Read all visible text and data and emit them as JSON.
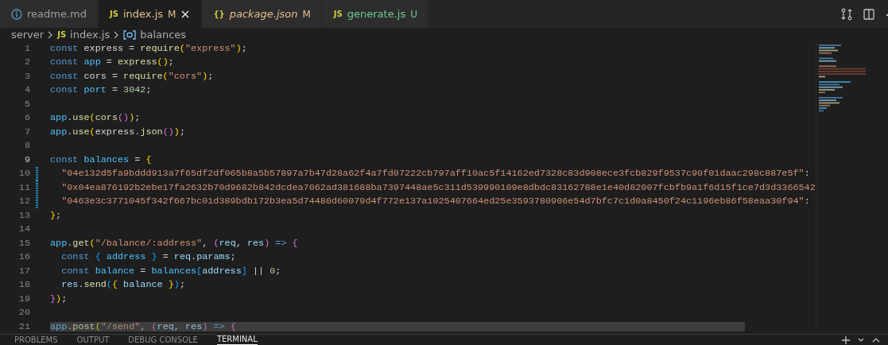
{
  "tabs": [
    {
      "kind": "info",
      "label": "readme.md",
      "selected": false,
      "italic": false,
      "color": "#9d9d9d"
    },
    {
      "kind": "badge",
      "badge": "JS",
      "label": "index.js",
      "status": "M",
      "selected": true,
      "italic": false,
      "color": "#e2c08d"
    },
    {
      "kind": "badge",
      "badge": "{}",
      "label": "package.json",
      "status": "M",
      "selected": false,
      "italic": true,
      "color": "#e2c08d"
    },
    {
      "kind": "badge",
      "badge": "JS",
      "label": "generate.js",
      "status": "U",
      "selected": false,
      "italic": false,
      "color": "#73c991"
    }
  ],
  "breadcrumb": [
    {
      "kind": "folder",
      "label": "server"
    },
    {
      "kind": "badge",
      "label": "index.js",
      "badge": "JS"
    },
    {
      "kind": "symbol",
      "label": "balances"
    }
  ],
  "lines": [
    {
      "number": "1",
      "active": false,
      "modified": false,
      "tokens": [
        {
          "kind": "keyword",
          "text": "const"
        },
        {
          "kind": "text",
          "text": " express = "
        },
        {
          "kind": "function",
          "text": "require"
        },
        {
          "kind": "bracket1",
          "text": "("
        },
        {
          "kind": "string",
          "text": "\"express\""
        },
        {
          "kind": "bracket1",
          "text": ")"
        },
        {
          "kind": "text",
          "text": ";"
        }
      ]
    },
    {
      "number": "2",
      "active": false,
      "modified": false,
      "tokens": [
        {
          "kind": "keyword",
          "text": "const"
        },
        {
          "kind": "constant",
          "text": " app"
        },
        {
          "kind": "text",
          "text": " = "
        },
        {
          "kind": "function",
          "text": "express"
        },
        {
          "kind": "bracket1",
          "text": "()"
        },
        {
          "kind": "text",
          "text": ";"
        }
      ]
    },
    {
      "number": "3",
      "active": false,
      "modified": false,
      "tokens": [
        {
          "kind": "keyword",
          "text": "const"
        },
        {
          "kind": "text",
          "text": " cors = "
        },
        {
          "kind": "function",
          "text": "require"
        },
        {
          "kind": "bracket1",
          "text": "("
        },
        {
          "kind": "string",
          "text": "\"cors\""
        },
        {
          "kind": "bracket1",
          "text": ")"
        },
        {
          "kind": "text",
          "text": ";"
        }
      ]
    },
    {
      "number": "4",
      "active": false,
      "modified": false,
      "tokens": [
        {
          "kind": "keyword",
          "text": "const"
        },
        {
          "kind": "constant",
          "text": " port"
        },
        {
          "kind": "text",
          "text": " = "
        },
        {
          "kind": "number",
          "text": "3042"
        },
        {
          "kind": "text",
          "text": ";"
        }
      ]
    },
    {
      "number": "5",
      "active": false,
      "modified": false
    },
    {
      "number": "6",
      "active": false,
      "modified": false,
      "tokens": [
        {
          "kind": "constant",
          "text": "app"
        },
        {
          "kind": "text",
          "text": "."
        },
        {
          "kind": "function",
          "text": "use"
        },
        {
          "kind": "bracket1",
          "text": "("
        },
        {
          "kind": "function",
          "text": "cors"
        },
        {
          "kind": "bracket2",
          "text": "()"
        },
        {
          "kind": "bracket1",
          "text": ")"
        },
        {
          "kind": "text",
          "text": ";"
        }
      ]
    },
    {
      "number": "7",
      "active": false,
      "modified": false,
      "tokens": [
        {
          "kind": "constant",
          "text": "app"
        },
        {
          "kind": "text",
          "text": "."
        },
        {
          "kind": "function",
          "text": "use"
        },
        {
          "kind": "bracket1",
          "text": "("
        },
        {
          "kind": "text",
          "text": "express."
        },
        {
          "kind": "function",
          "text": "json"
        },
        {
          "kind": "bracket2",
          "text": "()"
        },
        {
          "kind": "bracket1",
          "text": ")"
        },
        {
          "kind": "text",
          "text": ";"
        }
      ]
    },
    {
      "number": "8",
      "active": false,
      "modified": false
    },
    {
      "number": "9",
      "active": true,
      "modified": false,
      "tokens": [
        {
          "kind": "keyword",
          "text": "const"
        },
        {
          "kind": "constant",
          "text": " balances"
        },
        {
          "kind": "text",
          "text": " = "
        },
        {
          "kind": "bracket1",
          "text": "{"
        }
      ]
    },
    {
      "number": "10",
      "active": false,
      "modified": true,
      "tokens": [
        {
          "kind": "string",
          "text": "  \"04e132d5fa9bddd913a7f65df2df065b8a5b57897a7b47d28a62f4a7fd07222cb797aff10ac5f14162ed7328c83d908ece3fcb829f9537c90f01daac298c887e5f\""
        },
        {
          "kind": "text",
          "text": ":"
        }
      ]
    },
    {
      "number": "11",
      "active": false,
      "modified": true,
      "tokens": [
        {
          "kind": "string",
          "text": "  \"0x04ea876192b2ebe17fa2632b70d9682b842dcdea7062ad381688ba7397448ae5c311d539990109e8dbdc83162788e1e40d82007fcbfb9a1f6d15f1ce7d3d3366542"
        }
      ]
    },
    {
      "number": "12",
      "active": false,
      "modified": true,
      "tokens": [
        {
          "kind": "string",
          "text": "  \"0463e3c3771045f342f667bc01d389bdb172b3ea5d74480d60079d4f772e137a1025407664ed25e3593780906e54d7bfc7c1d0a8450f24c1196eb86f58eaa30f94\""
        },
        {
          "kind": "text",
          "text": ":"
        }
      ]
    },
    {
      "number": "13",
      "active": false,
      "modified": false,
      "tokens": [
        {
          "kind": "bracket1",
          "text": "}"
        },
        {
          "kind": "text",
          "text": ";"
        }
      ]
    },
    {
      "number": "14",
      "active": false,
      "modified": false
    },
    {
      "number": "15",
      "active": false,
      "modified": false,
      "tokens": [
        {
          "kind": "constant",
          "text": "app"
        },
        {
          "kind": "text",
          "text": "."
        },
        {
          "kind": "function",
          "text": "get"
        },
        {
          "kind": "bracket1",
          "text": "("
        },
        {
          "kind": "string",
          "text": "\"/balance/:address\""
        },
        {
          "kind": "text",
          "text": ", "
        },
        {
          "kind": "bracket2",
          "text": "("
        },
        {
          "kind": "variable",
          "text": "req"
        },
        {
          "kind": "text",
          "text": ", "
        },
        {
          "kind": "variable",
          "text": "res"
        },
        {
          "kind": "bracket2",
          "text": ")"
        },
        {
          "kind": "keyword",
          "text": " => "
        },
        {
          "kind": "bracket2",
          "text": "{"
        }
      ]
    },
    {
      "number": "16",
      "active": false,
      "modified": false,
      "tokens": [
        {
          "kind": "keyword",
          "text": "  const "
        },
        {
          "kind": "bracket3",
          "text": "{"
        },
        {
          "kind": "constant",
          "text": " address "
        },
        {
          "kind": "bracket3",
          "text": "}"
        },
        {
          "kind": "text",
          "text": " = "
        },
        {
          "kind": "variable",
          "text": "req"
        },
        {
          "kind": "text",
          "text": "."
        },
        {
          "kind": "variable",
          "text": "params"
        },
        {
          "kind": "text",
          "text": ";"
        }
      ]
    },
    {
      "number": "17",
      "active": false,
      "modified": false,
      "tokens": [
        {
          "kind": "keyword",
          "text": "  const"
        },
        {
          "kind": "constant",
          "text": " balance"
        },
        {
          "kind": "text",
          "text": " = "
        },
        {
          "kind": "constant",
          "text": "balances"
        },
        {
          "kind": "bracket3",
          "text": "["
        },
        {
          "kind": "variable",
          "text": "address"
        },
        {
          "kind": "bracket3",
          "text": "]"
        },
        {
          "kind": "text",
          "text": " || "
        },
        {
          "kind": "number",
          "text": "0"
        },
        {
          "kind": "text",
          "text": ";"
        }
      ]
    },
    {
      "number": "18",
      "active": false,
      "modified": false,
      "tokens": [
        {
          "kind": "variable",
          "text": "  res"
        },
        {
          "kind": "text",
          "text": "."
        },
        {
          "kind": "function",
          "text": "send"
        },
        {
          "kind": "bracket3",
          "text": "("
        },
        {
          "kind": "bracket1",
          "text": "{"
        },
        {
          "kind": "variable",
          "text": " balance "
        },
        {
          "kind": "bracket1",
          "text": "}"
        },
        {
          "kind": "bracket3",
          "text": ")"
        },
        {
          "kind": "text",
          "text": ";"
        }
      ]
    },
    {
      "number": "19",
      "active": false,
      "modified": false,
      "tokens": [
        {
          "kind": "bracket2",
          "text": "}"
        },
        {
          "kind": "bracket1",
          "text": ")"
        },
        {
          "kind": "text",
          "text": ";"
        }
      ]
    },
    {
      "number": "20",
      "active": false,
      "modified": false
    },
    {
      "number": "21",
      "active": false,
      "modified": false,
      "tokens": [
        {
          "kind": "constant",
          "text": "app"
        },
        {
          "kind": "text",
          "text": "."
        },
        {
          "kind": "function",
          "text": "post"
        },
        {
          "kind": "bracket1",
          "text": "("
        },
        {
          "kind": "string",
          "text": "\"/send\""
        },
        {
          "kind": "text",
          "text": ", "
        },
        {
          "kind": "bracket2",
          "text": "("
        },
        {
          "kind": "variable",
          "text": "req"
        },
        {
          "kind": "text",
          "text": ", "
        },
        {
          "kind": "variable",
          "text": "res"
        },
        {
          "kind": "bracket2",
          "text": ")"
        },
        {
          "kind": "keyword",
          "text": " => "
        },
        {
          "kind": "bracket2",
          "text": "{"
        }
      ]
    }
  ],
  "panel_tabs": [
    {
      "label": "PROBLEMS",
      "selected": false
    },
    {
      "label": "OUTPUT",
      "selected": false
    },
    {
      "label": "DEBUG CONSOLE",
      "selected": false
    },
    {
      "label": "TERMINAL",
      "selected": true
    }
  ]
}
